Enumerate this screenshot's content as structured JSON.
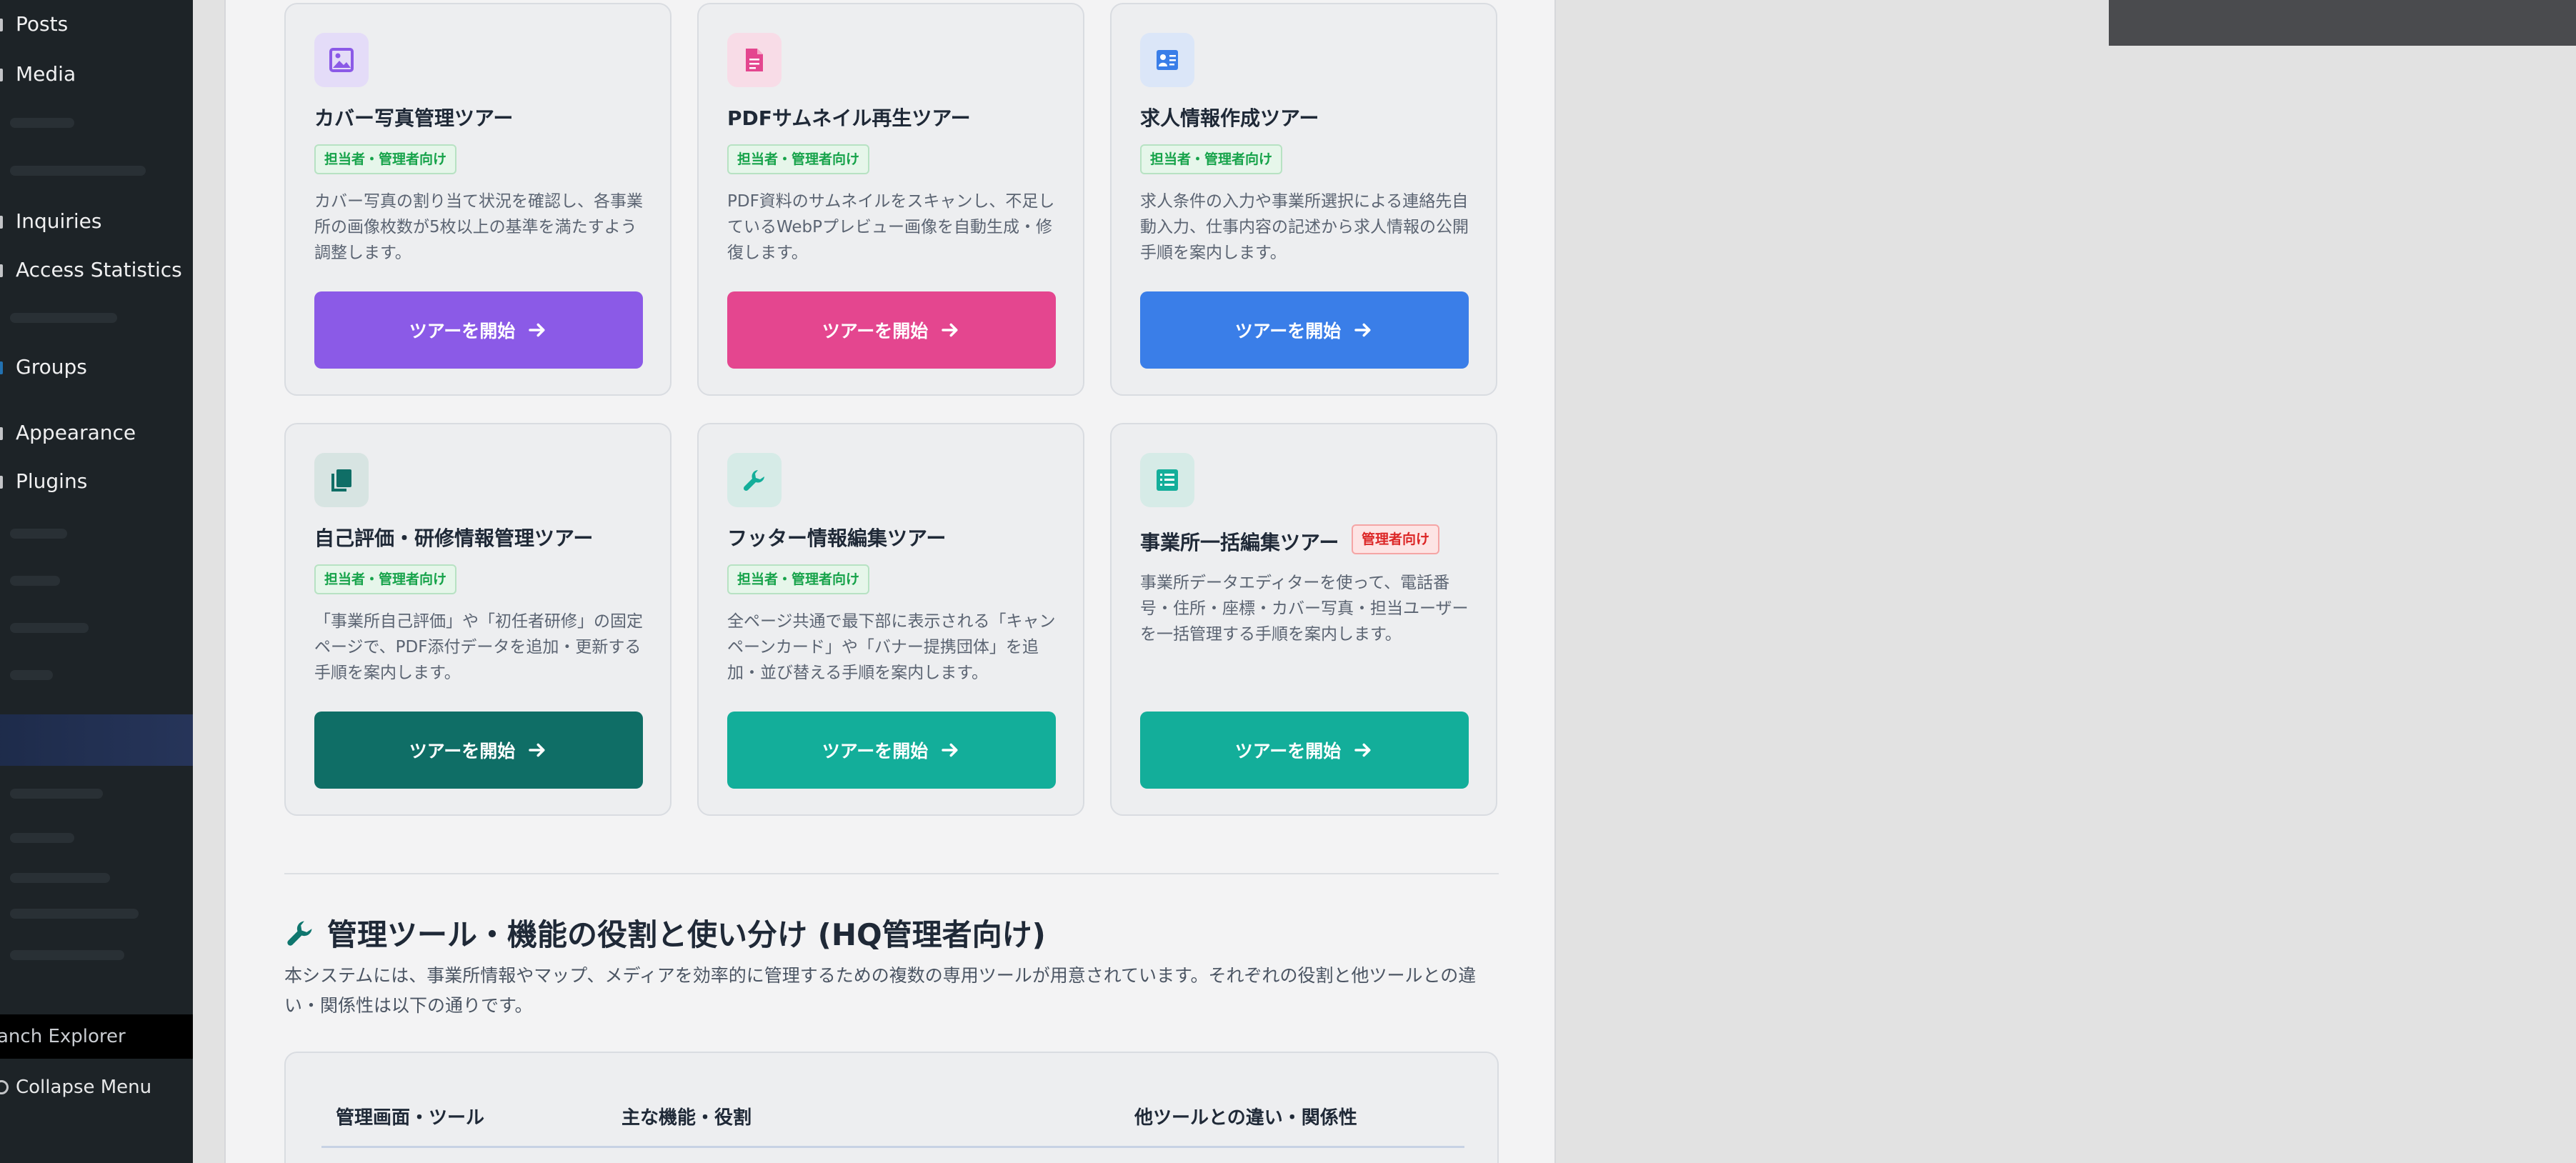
{
  "sidebar": {
    "items": [
      {
        "label": "Posts"
      },
      {
        "label": "Media"
      },
      {
        "label": "Inquiries"
      },
      {
        "label": "Access Statistics"
      },
      {
        "label": "Groups"
      },
      {
        "label": "Appearance"
      },
      {
        "label": "Plugins"
      }
    ],
    "explorer_label": "anch Explorer",
    "collapse_label": "Collapse Menu"
  },
  "tours": [
    {
      "title": "カバー写真管理ツアー",
      "badge": "担当者・管理者向け",
      "description": "カバー写真の割り当て状況を確認し、各事業所の画像枚数が5枚以上の基準を満たすよう調整します。",
      "button": "ツアーを開始",
      "icon": "image-icon",
      "color": "#8b5ae7"
    },
    {
      "title": "PDFサムネイル再生ツアー",
      "badge": "担当者・管理者向け",
      "description": "PDF資料のサムネイルをスキャンし、不足しているWebPプレビュー画像を自動生成・修復します。",
      "button": "ツアーを開始",
      "icon": "pdf-file-icon",
      "color": "#e4468f"
    },
    {
      "title": "求人情報作成ツアー",
      "badge": "担当者・管理者向け",
      "description": "求人条件の入力や事業所選択による連絡先自動入力、仕事内容の記述から求人情報の公開手順を案内します。",
      "button": "ツアーを開始",
      "icon": "id-card-icon",
      "color": "#3a7ee8"
    },
    {
      "title": "自己評価・研修情報管理ツアー",
      "badge": "担当者・管理者向け",
      "description": "「事業所自己評価」や「初任者研修」の固定ページで、PDF添付データを追加・更新する手順を案内します。",
      "button": "ツアーを開始",
      "icon": "documents-icon",
      "color": "#0f6e66"
    },
    {
      "title": "フッター情報編集ツアー",
      "badge": "担当者・管理者向け",
      "description": "全ページ共通で最下部に表示される「キャンペーンカード」や「バナー提携団体」を追加・並び替える手順を案内します。",
      "button": "ツアーを開始",
      "icon": "wrench-icon",
      "color": "#13ae9a"
    },
    {
      "title": "事業所一括編集ツアー",
      "badge": "管理者向け",
      "description": "事業所データエディターを使って、電話番号・住所・座標・カバー写真・担当ユーザーを一括管理する手順を案内します。",
      "button": "ツアーを開始",
      "icon": "list-icon",
      "color": "#13ae9a"
    }
  ],
  "section": {
    "title": "管理ツール・機能の役割と使い分け (HQ管理者向け)",
    "description": "本システムには、事業所情報やマップ、メディアを効率的に管理するための複数の専用ツールが用意されています。それぞれの役割と他ツールとの違い・関係性は以下の通りです。",
    "table_headers": [
      "管理画面・ツール",
      "主な機能・役割",
      "他ツールとの違い・関係性"
    ]
  }
}
